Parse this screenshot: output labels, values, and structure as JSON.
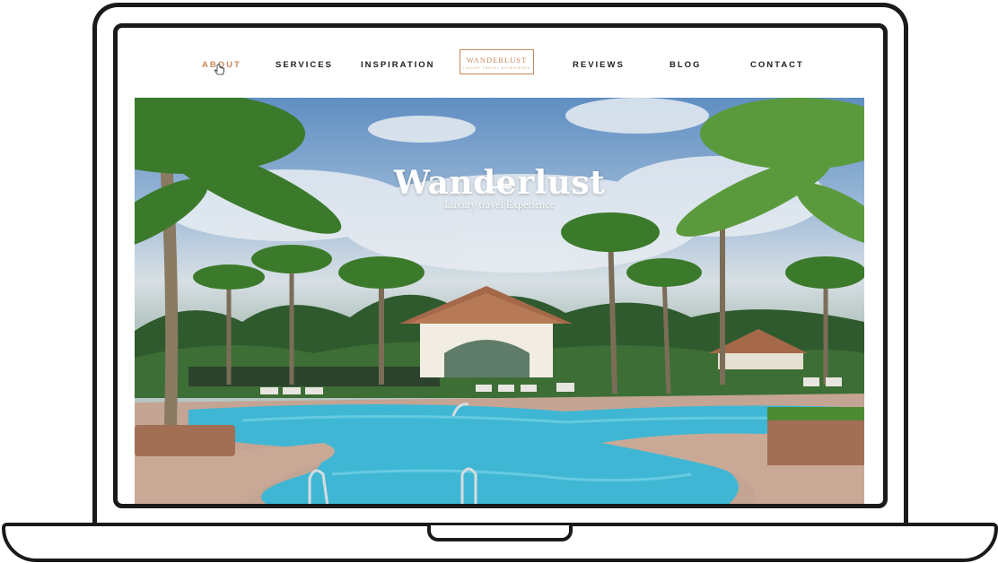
{
  "nav": {
    "items_left": [
      "ABOUT",
      "SERVICES",
      "INSPIRATION"
    ],
    "logo": {
      "title": "WANDERLUST",
      "tagline": "LUXURY TRAVEL EXPERIENCE"
    },
    "items_right": [
      "REVIEWS",
      "BLOG",
      "CONTACT"
    ],
    "active_item": "ABOUT"
  },
  "hero": {
    "title": "Wanderlust",
    "subtitle": "Luxury travel Experience"
  },
  "colors": {
    "accent": "#c8875a",
    "text": "#1d1d1d",
    "frame": "#1a1a1a",
    "pool": "#3fb7d4"
  },
  "icons": [
    "hand-pointer-cursor-icon"
  ]
}
